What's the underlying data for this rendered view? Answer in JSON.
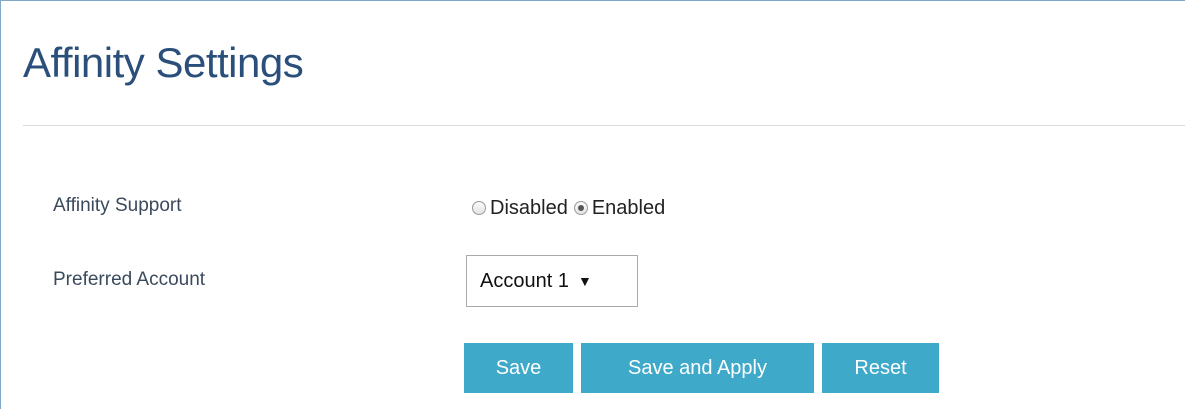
{
  "page": {
    "title": "Affinity Settings"
  },
  "form": {
    "affinity_support": {
      "label": "Affinity Support",
      "options": [
        {
          "label": "Disabled",
          "checked": false
        },
        {
          "label": "Enabled",
          "checked": true
        }
      ]
    },
    "preferred_account": {
      "label": "Preferred Account",
      "selected": "Account 1"
    }
  },
  "buttons": {
    "save": "Save",
    "save_and_apply": "Save and Apply",
    "reset": "Reset"
  },
  "colors": {
    "title": "#2a4f7a",
    "button_bg": "#3fa9c9",
    "button_text": "#ffffff",
    "frame_border": "#7fa8c9"
  },
  "icons": {
    "select_arrow": "dropdown-arrow-icon"
  }
}
